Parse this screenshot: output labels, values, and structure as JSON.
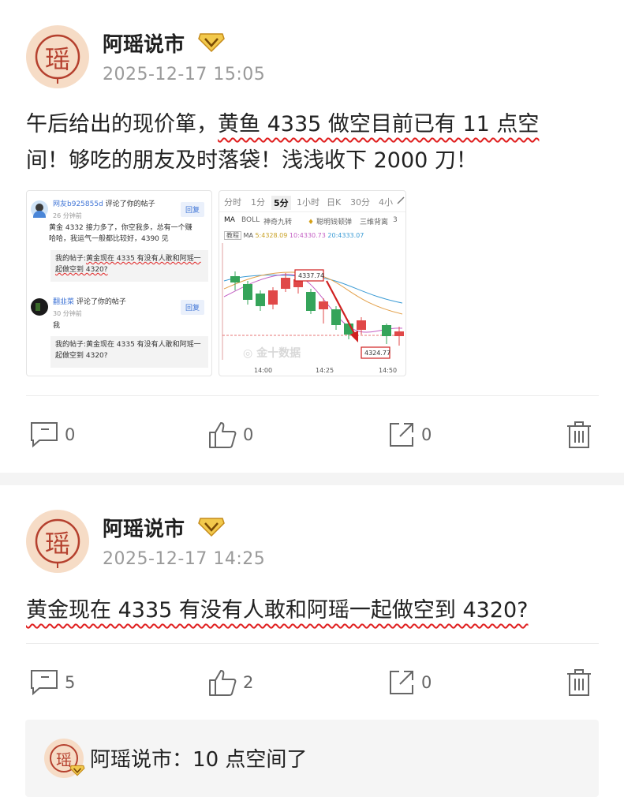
{
  "post1": {
    "author": "阿瑶说市",
    "avatar_char": "瑶",
    "time": "2025-12-17 15:05",
    "text_before": "午后给出的现价箪，",
    "text_highlight": "黄鱼 4335 做空目前已有 11 点空",
    "text_line2": "间！够吃的朋友及时落袋！浅浅收下 2000 刀！",
    "comment_count": "0",
    "like_count": "0",
    "share_count": "0"
  },
  "thumb_left": {
    "c1_user": "网友b925855d",
    "c1_action": "评论了你的帖子",
    "c1_time": "26 分钟前",
    "c1_text": "黄金 4332 接力多了，你空我多，总有一个赚哈哈，我运气一般都比较好，4390 见",
    "c1_quote_prefix": "我的帖子:",
    "c1_quote_line1": "黄金现在 4335 有没有人敢和阿瑶一",
    "c1_quote_line2": "起做空到 4320?",
    "reply_label": "回复",
    "c2_user": "翻韭菜",
    "c2_action": "评论了你的帖子",
    "c2_time": "30 分钟前",
    "c2_text": "我",
    "c2_quote_line1": "我的帖子:黄金现在 4335 有没有人敢和阿瑶一",
    "c2_quote_line2": "起做空到 4320?"
  },
  "thumb_chart": {
    "tabs": [
      "分时",
      "1分",
      "5分",
      "1小时",
      "日K",
      "30分",
      "4小"
    ],
    "active_tab": "5分",
    "indicators": [
      "MA",
      "BOLL",
      "神奇九转",
      "聪明钱",
      "顿弹",
      "三维背离",
      "3"
    ],
    "ma_tag": "教程",
    "ma_line_label": "MA",
    "ma5": "5:4328.09",
    "ma10": "10:4330.73",
    "ma20": "20:4333.07",
    "high_label": "4337.74",
    "low_label": "4324.77",
    "watermark": "金十数据",
    "time_ticks": [
      "14:00",
      "14:25",
      "14:50"
    ],
    "colors": {
      "up": "#e04848",
      "down": "#35a45a"
    },
    "chart_data": {
      "type": "candlestick",
      "x": [
        "14:00",
        "14:25",
        "14:50"
      ],
      "annotations": [
        "4337.74",
        "4324.77"
      ]
    }
  },
  "post2": {
    "author": "阿瑶说市",
    "avatar_char": "瑶",
    "time": "2025-12-17 14:25",
    "text": "黄金现在 4335 有没有人敢和阿瑶一起做空到 4320?",
    "comment_count": "5",
    "like_count": "2",
    "share_count": "0"
  },
  "reply": {
    "author": "阿瑶说市",
    "separator": "：",
    "text": "10 点空间了"
  }
}
